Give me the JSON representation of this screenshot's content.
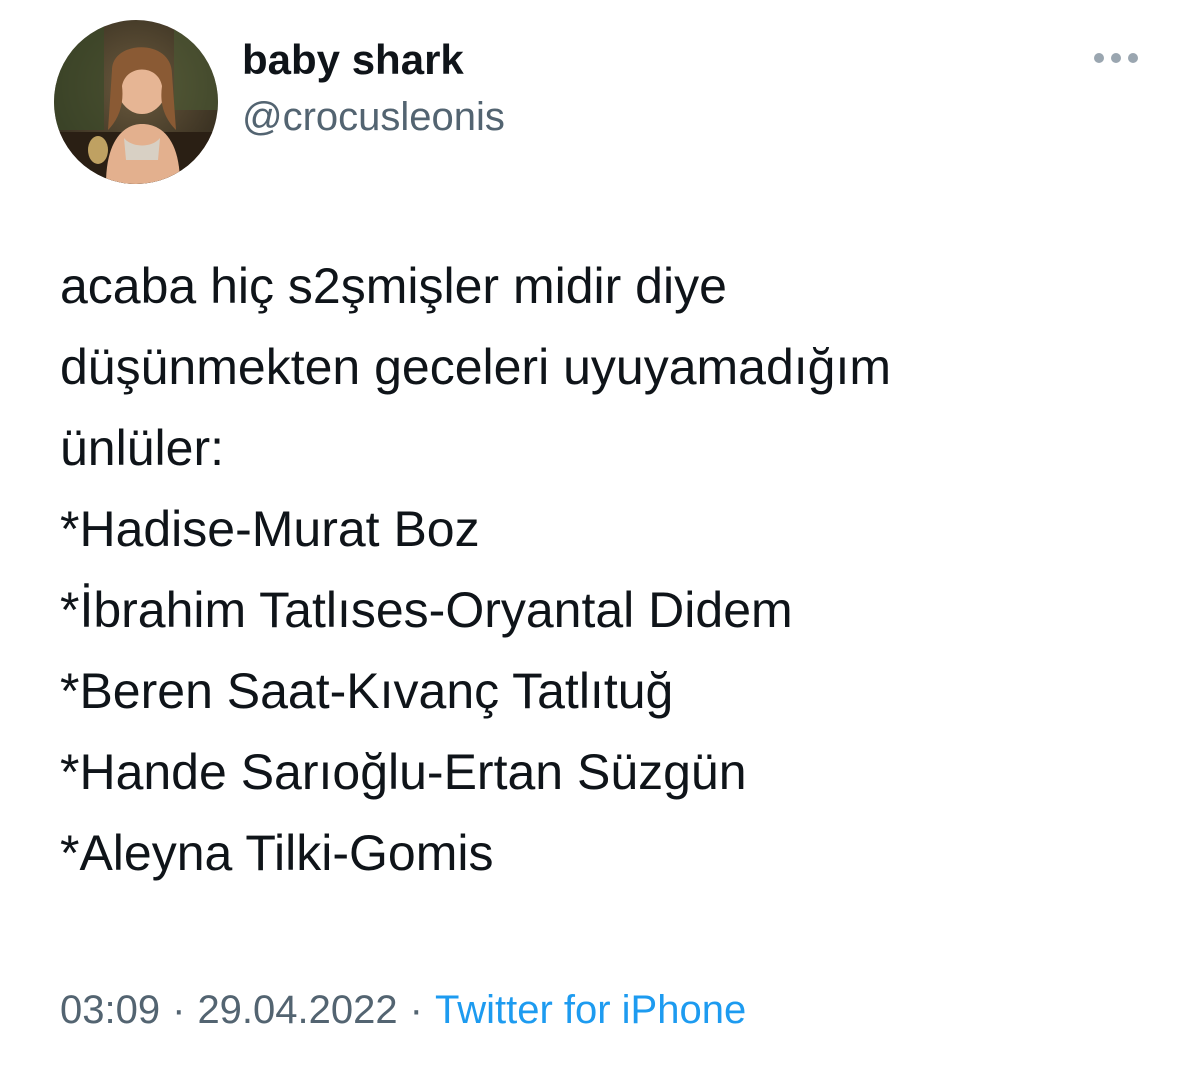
{
  "author": {
    "display_name": "baby shark",
    "handle": "@crocusleonis",
    "avatar_icon": "profile-photo"
  },
  "more_icon": "more-horizontal-icon",
  "tweet": {
    "lines": [
      "acaba hiç s2şmişler midir diye",
      "düşünmekten geceleri uyuyamadığım",
      "ünlüler:",
      "*Hadise-Murat Boz",
      "*İbrahim Tatlıses-Oryantal Didem",
      "*Beren Saat-Kıvanç Tatlıtuğ",
      "*Hande Sarıoğlu-Ertan Süzgün",
      "*Aleyna Tilki-Gomis"
    ]
  },
  "meta": {
    "time": "03:09",
    "separator": "·",
    "date": "29.04.2022",
    "source": "Twitter for iPhone"
  },
  "colors": {
    "text_primary": "#0f1419",
    "text_secondary": "#536471",
    "link": "#1d9bf0"
  }
}
